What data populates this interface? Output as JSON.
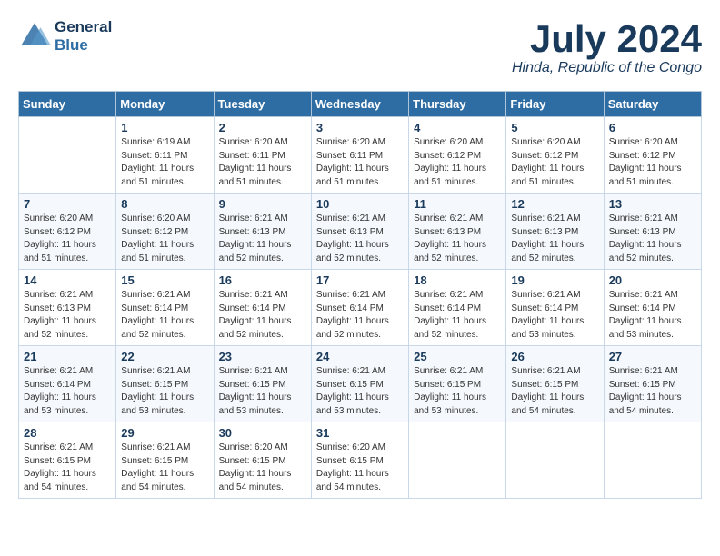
{
  "header": {
    "logo_line1": "General",
    "logo_line2": "Blue",
    "month": "July 2024",
    "location": "Hinda, Republic of the Congo"
  },
  "days_of_week": [
    "Sunday",
    "Monday",
    "Tuesday",
    "Wednesday",
    "Thursday",
    "Friday",
    "Saturday"
  ],
  "weeks": [
    [
      {
        "day": "",
        "info": ""
      },
      {
        "day": "1",
        "info": "Sunrise: 6:19 AM\nSunset: 6:11 PM\nDaylight: 11 hours\nand 51 minutes."
      },
      {
        "day": "2",
        "info": "Sunrise: 6:20 AM\nSunset: 6:11 PM\nDaylight: 11 hours\nand 51 minutes."
      },
      {
        "day": "3",
        "info": "Sunrise: 6:20 AM\nSunset: 6:11 PM\nDaylight: 11 hours\nand 51 minutes."
      },
      {
        "day": "4",
        "info": "Sunrise: 6:20 AM\nSunset: 6:12 PM\nDaylight: 11 hours\nand 51 minutes."
      },
      {
        "day": "5",
        "info": "Sunrise: 6:20 AM\nSunset: 6:12 PM\nDaylight: 11 hours\nand 51 minutes."
      },
      {
        "day": "6",
        "info": "Sunrise: 6:20 AM\nSunset: 6:12 PM\nDaylight: 11 hours\nand 51 minutes."
      }
    ],
    [
      {
        "day": "7",
        "info": "Sunrise: 6:20 AM\nSunset: 6:12 PM\nDaylight: 11 hours\nand 51 minutes."
      },
      {
        "day": "8",
        "info": "Sunrise: 6:20 AM\nSunset: 6:12 PM\nDaylight: 11 hours\nand 51 minutes."
      },
      {
        "day": "9",
        "info": "Sunrise: 6:21 AM\nSunset: 6:13 PM\nDaylight: 11 hours\nand 52 minutes."
      },
      {
        "day": "10",
        "info": "Sunrise: 6:21 AM\nSunset: 6:13 PM\nDaylight: 11 hours\nand 52 minutes."
      },
      {
        "day": "11",
        "info": "Sunrise: 6:21 AM\nSunset: 6:13 PM\nDaylight: 11 hours\nand 52 minutes."
      },
      {
        "day": "12",
        "info": "Sunrise: 6:21 AM\nSunset: 6:13 PM\nDaylight: 11 hours\nand 52 minutes."
      },
      {
        "day": "13",
        "info": "Sunrise: 6:21 AM\nSunset: 6:13 PM\nDaylight: 11 hours\nand 52 minutes."
      }
    ],
    [
      {
        "day": "14",
        "info": "Sunrise: 6:21 AM\nSunset: 6:13 PM\nDaylight: 11 hours\nand 52 minutes."
      },
      {
        "day": "15",
        "info": "Sunrise: 6:21 AM\nSunset: 6:14 PM\nDaylight: 11 hours\nand 52 minutes."
      },
      {
        "day": "16",
        "info": "Sunrise: 6:21 AM\nSunset: 6:14 PM\nDaylight: 11 hours\nand 52 minutes."
      },
      {
        "day": "17",
        "info": "Sunrise: 6:21 AM\nSunset: 6:14 PM\nDaylight: 11 hours\nand 52 minutes."
      },
      {
        "day": "18",
        "info": "Sunrise: 6:21 AM\nSunset: 6:14 PM\nDaylight: 11 hours\nand 52 minutes."
      },
      {
        "day": "19",
        "info": "Sunrise: 6:21 AM\nSunset: 6:14 PM\nDaylight: 11 hours\nand 53 minutes."
      },
      {
        "day": "20",
        "info": "Sunrise: 6:21 AM\nSunset: 6:14 PM\nDaylight: 11 hours\nand 53 minutes."
      }
    ],
    [
      {
        "day": "21",
        "info": "Sunrise: 6:21 AM\nSunset: 6:14 PM\nDaylight: 11 hours\nand 53 minutes."
      },
      {
        "day": "22",
        "info": "Sunrise: 6:21 AM\nSunset: 6:15 PM\nDaylight: 11 hours\nand 53 minutes."
      },
      {
        "day": "23",
        "info": "Sunrise: 6:21 AM\nSunset: 6:15 PM\nDaylight: 11 hours\nand 53 minutes."
      },
      {
        "day": "24",
        "info": "Sunrise: 6:21 AM\nSunset: 6:15 PM\nDaylight: 11 hours\nand 53 minutes."
      },
      {
        "day": "25",
        "info": "Sunrise: 6:21 AM\nSunset: 6:15 PM\nDaylight: 11 hours\nand 53 minutes."
      },
      {
        "day": "26",
        "info": "Sunrise: 6:21 AM\nSunset: 6:15 PM\nDaylight: 11 hours\nand 54 minutes."
      },
      {
        "day": "27",
        "info": "Sunrise: 6:21 AM\nSunset: 6:15 PM\nDaylight: 11 hours\nand 54 minutes."
      }
    ],
    [
      {
        "day": "28",
        "info": "Sunrise: 6:21 AM\nSunset: 6:15 PM\nDaylight: 11 hours\nand 54 minutes."
      },
      {
        "day": "29",
        "info": "Sunrise: 6:21 AM\nSunset: 6:15 PM\nDaylight: 11 hours\nand 54 minutes."
      },
      {
        "day": "30",
        "info": "Sunrise: 6:20 AM\nSunset: 6:15 PM\nDaylight: 11 hours\nand 54 minutes."
      },
      {
        "day": "31",
        "info": "Sunrise: 6:20 AM\nSunset: 6:15 PM\nDaylight: 11 hours\nand 54 minutes."
      },
      {
        "day": "",
        "info": ""
      },
      {
        "day": "",
        "info": ""
      },
      {
        "day": "",
        "info": ""
      }
    ]
  ]
}
